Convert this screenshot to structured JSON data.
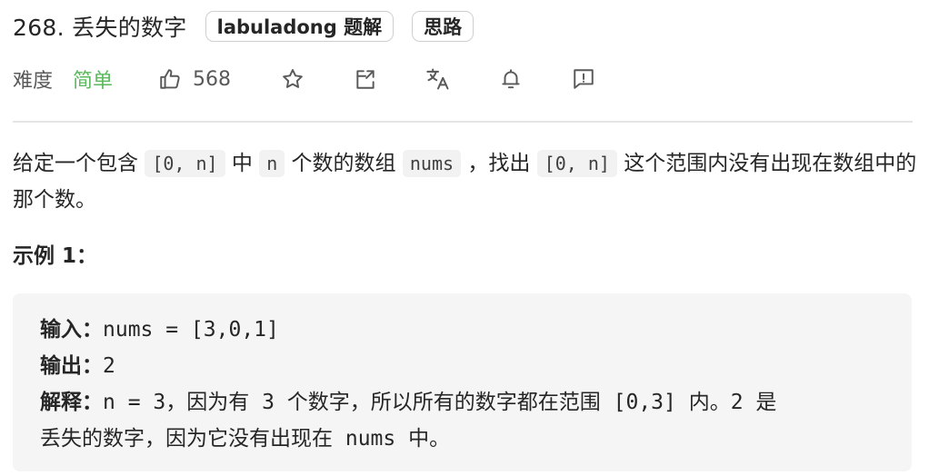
{
  "title": "268. 丢失的数字",
  "tags": [
    "labuladong 题解",
    "思路"
  ],
  "meta": {
    "difficulty_label": "难度",
    "difficulty": "简单",
    "likes": "568"
  },
  "icons": [
    "thumbs-up-icon",
    "star-icon",
    "share-icon",
    "translate-icon",
    "bell-icon",
    "feedback-icon"
  ],
  "colors": {
    "easy": "#5cb85c",
    "code_bg": "#f5f5f5"
  },
  "description": {
    "t1": "给定一个包含 ",
    "c1": "[0, n]",
    "t2": " 中 ",
    "c2": "n",
    "t3": " 个数的数组 ",
    "c3": "nums",
    "t4": " ，找出 ",
    "c4": "[0, n]",
    "t5": " 这个范围内没有出现在数组中的那个数。"
  },
  "example": {
    "title": "示例 1：",
    "input_label": "输入：",
    "input_value": "nums = [3,0,1]",
    "output_label": "输出：",
    "output_value": "2",
    "explain_label": "解释：",
    "explain_line1": "n = 3，因为有 3 个数字，所以所有的数字都在范围 [0,3] 内。2 是",
    "explain_line2": "丢失的数字，因为它没有出现在 nums 中。"
  }
}
